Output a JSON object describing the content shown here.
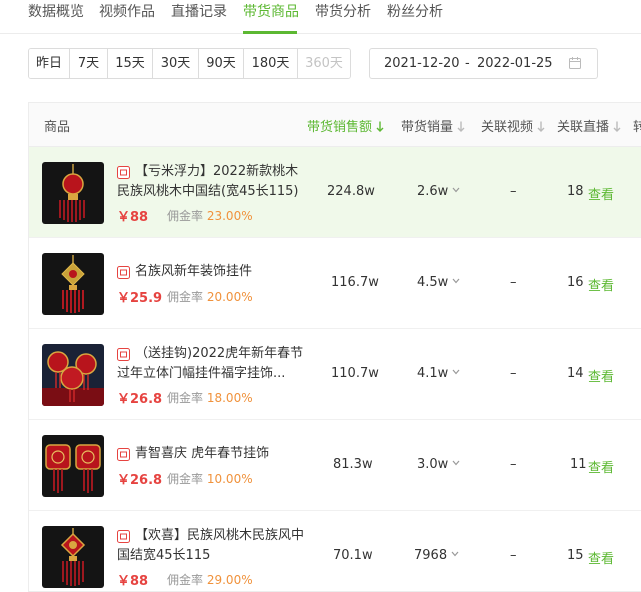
{
  "tabs": [
    {
      "label": "数据概览",
      "active": false
    },
    {
      "label": "视频作品",
      "active": false
    },
    {
      "label": "直播记录",
      "active": false
    },
    {
      "label": "带货商品",
      "active": true
    },
    {
      "label": "带货分析",
      "active": false
    },
    {
      "label": "粉丝分析",
      "active": false
    }
  ],
  "range_buttons": [
    {
      "label": "昨日",
      "disabled": false
    },
    {
      "label": "7天",
      "disabled": false
    },
    {
      "label": "15天",
      "disabled": false
    },
    {
      "label": "30天",
      "disabled": false
    },
    {
      "label": "90天",
      "disabled": false
    },
    {
      "label": "180天",
      "disabled": false
    },
    {
      "label": "360天",
      "disabled": true
    }
  ],
  "date_range": {
    "start": "2021-12-20",
    "separator": "-",
    "end": "2022-01-25"
  },
  "table": {
    "headers": {
      "product": "商品",
      "sales_amount": "带货销售额",
      "sales_volume": "带货销量",
      "related_videos": "关联视频",
      "related_lives": "关联直播",
      "cut": "转"
    },
    "commission_label": "佣金率",
    "view_label": "查看",
    "rows": [
      {
        "title": "【亏米浮力】2022新款桃木民族风桃木中国结(宽45长115)",
        "price": "￥88",
        "commission": "23.00%",
        "sales_amount": "224.8w",
        "sales_volume": "2.6w",
        "related_videos": "–",
        "related_lives": "18",
        "highlight": true
      },
      {
        "title": "名族风新年装饰挂件",
        "price": "￥25.9",
        "commission": "20.00%",
        "sales_amount": "116.7w",
        "sales_volume": "4.5w",
        "related_videos": "–",
        "related_lives": "16",
        "highlight": false
      },
      {
        "title": "（送挂钩)2022虎年新年春节过年立体门幅挂件福字挂饰...",
        "price": "￥26.8",
        "commission": "18.00%",
        "sales_amount": "110.7w",
        "sales_volume": "4.1w",
        "related_videos": "–",
        "related_lives": "14",
        "highlight": false
      },
      {
        "title": "青智喜庆 虎年春节挂饰",
        "price": "￥26.8",
        "commission": "10.00%",
        "sales_amount": "81.3w",
        "sales_volume": "3.0w",
        "related_videos": "–",
        "related_lives": "11",
        "highlight": false
      },
      {
        "title": "【欢喜】民族风桃木民族风中国结宽45长115",
        "price": "￥88",
        "commission": "29.00%",
        "sales_amount": "70.1w",
        "sales_volume": "7968",
        "related_videos": "–",
        "related_lives": "15",
        "highlight": false
      }
    ]
  },
  "colors": {
    "accent": "#5cb832",
    "price": "#e64340",
    "commission": "#f0923c",
    "highlight_row": "#f0f9ea"
  },
  "icons": [
    "calendar-icon",
    "sort-arrow-icon",
    "chevron-down-icon",
    "shop-icon"
  ]
}
